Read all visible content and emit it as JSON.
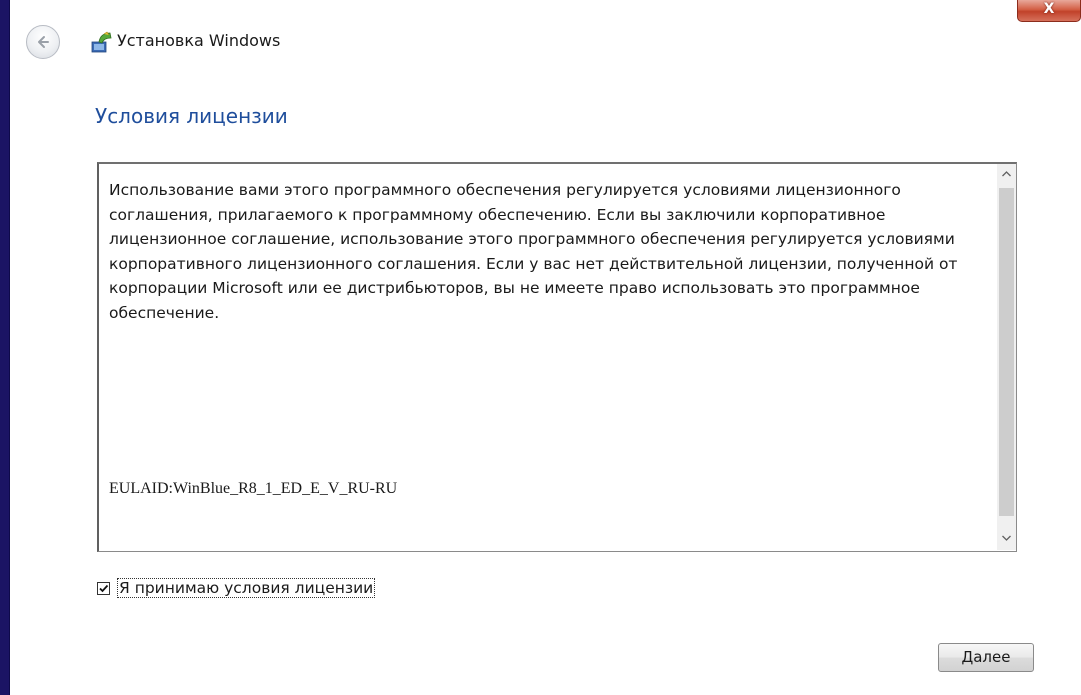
{
  "window": {
    "title": "Установка Windows",
    "close_label": "X"
  },
  "page": {
    "heading": "Условия лицензии"
  },
  "license": {
    "text": "Использование вами этого программного обеспечения регулируется условиями лицензионного соглашения, прилагаемого к программному обеспечению. Если вы заключили корпоративное лицензионное соглашение, использование этого программного обеспечения регулируется условиями корпоративного лицензионного соглашения. Если у вас нет действительной лицензии, полученной от корпорации Microsoft или ее дистрибьюторов, вы не имеете право использовать это программное обеспечение.",
    "eula_id": "EULAID:WinBlue_R8_1_ED_E_V_RU-RU"
  },
  "accept": {
    "checked": true,
    "label": "Я принимаю условия лицензии"
  },
  "buttons": {
    "next_first": "Д",
    "next_rest": "алее"
  },
  "icons": {
    "back": "back-arrow-icon",
    "app": "windows-setup-icon",
    "close": "close-icon",
    "scroll_up": "chevron-up-icon",
    "scroll_down": "chevron-down-icon",
    "check": "checkmark-icon"
  },
  "colors": {
    "heading": "#1f4e9c",
    "desktop": "#1b1464",
    "close": "#c1412a"
  }
}
